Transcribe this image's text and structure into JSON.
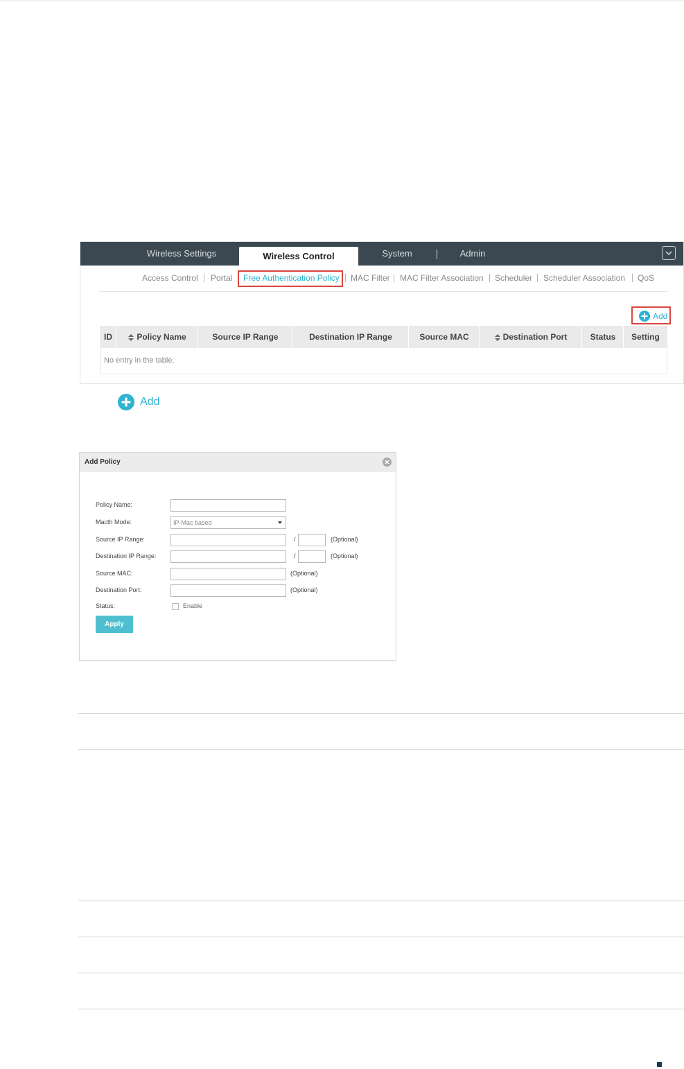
{
  "top_nav": {
    "tabs": [
      "Wireless Settings",
      "Wireless Control",
      "System",
      "Admin"
    ],
    "active_tab": "Wireless Control"
  },
  "sub_nav": {
    "items": [
      "Access Control",
      "Portal",
      "Free Authentication Policy",
      "MAC Filter",
      "MAC Filter Association",
      "Scheduler",
      "Scheduler Association",
      "QoS"
    ],
    "active_item": "Free Authentication Policy"
  },
  "table": {
    "add_label": "Add",
    "columns": [
      "ID",
      "Policy Name",
      "Source IP Range",
      "Destination IP Range",
      "Source MAC",
      "Destination Port",
      "Status",
      "Setting"
    ],
    "empty_message": "No entry in the table."
  },
  "standalone_add": {
    "label": "Add"
  },
  "dialog": {
    "title": "Add Policy",
    "fields": {
      "policy_name": {
        "label": "Policy Name:",
        "value": ""
      },
      "match_mode": {
        "label": "Macth Mode:",
        "value": "IP-Mac based"
      },
      "source_ip_range": {
        "label": "Source IP Range:",
        "value": "",
        "optional": "(Optional)"
      },
      "destination_ip_range": {
        "label": "Destination IP Range:",
        "value": "",
        "optional": "(Optional)"
      },
      "source_mac": {
        "label": "Source MAC:",
        "value": "",
        "optional": "(Optional)"
      },
      "destination_port": {
        "label": "Destination Port:",
        "value": "",
        "optional": "(Optional)"
      },
      "status": {
        "label": "Status:",
        "checkbox_label": "Enable",
        "checked": false
      }
    },
    "slash": "/",
    "apply_label": "Apply"
  },
  "colors": {
    "nav_bg": "#3b4851",
    "accent": "#2db3d0",
    "highlight": "#d9463e",
    "apply_bg": "#4fbfcf"
  }
}
